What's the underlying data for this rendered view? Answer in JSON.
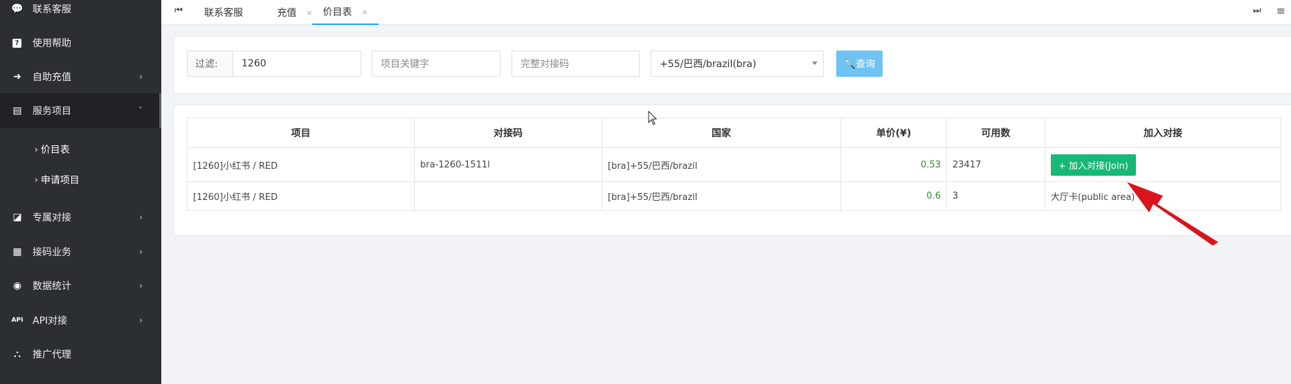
{
  "sidebar": {
    "items": [
      {
        "icon": "chat-icon",
        "glyph": "💬",
        "label": "联系客服",
        "arrow": ""
      },
      {
        "icon": "help-icon",
        "glyph": "?",
        "label": "使用帮助",
        "arrow": ""
      },
      {
        "icon": "recharge-icon",
        "glyph": "➜",
        "label": "自助充值",
        "arrow": "›"
      },
      {
        "icon": "service-icon",
        "glyph": "▤",
        "label": "服务项目",
        "arrow": "ˇ"
      },
      {
        "icon": "exclusive-icon",
        "glyph": "◪",
        "label": "专属对接",
        "arrow": "›"
      },
      {
        "icon": "sms-icon",
        "glyph": "▦",
        "label": "接码业务",
        "arrow": "›"
      },
      {
        "icon": "stats-icon",
        "glyph": "◉",
        "label": "数据统计",
        "arrow": "›"
      },
      {
        "icon": "api-icon",
        "glyph": "API",
        "label": "API对接",
        "arrow": "›"
      },
      {
        "icon": "promote-icon",
        "glyph": "⛬",
        "label": "推广代理",
        "arrow": ""
      }
    ],
    "sub_items": [
      {
        "label": "价目表"
      },
      {
        "label": "申请项目"
      }
    ]
  },
  "tabs": {
    "first_glyph": "⏮",
    "last_glyph": "⏭",
    "menu_glyph": "≡",
    "items": [
      {
        "label": "联系客服",
        "close": ""
      },
      {
        "label": "充值",
        "close": "×"
      },
      {
        "label": "价目表",
        "close": "×"
      }
    ]
  },
  "filter": {
    "label": "过滤:",
    "value": "1260",
    "keyword_placeholder": "项目关键字",
    "code_placeholder": "完整对接码",
    "country_selected": "+55/巴西/brazil(bra)",
    "query_label": "🔍查询"
  },
  "table": {
    "headers": [
      "项目",
      "对接码",
      "国家",
      "单价(¥)",
      "可用数",
      "加入对接"
    ],
    "rows": [
      {
        "project": "[1260]小红书 / RED",
        "code": "bra-1260-1511l",
        "country": "[bra]+55/巴西/brazil",
        "price": "0.53",
        "available": "23417",
        "action": "+ 加入对接(Join)"
      },
      {
        "project": "[1260]小红书 / RED",
        "code": "",
        "country": "[bra]+55/巴西/brazil",
        "price": "0.6",
        "available": "3",
        "action": "大厅卡(public area)"
      }
    ]
  },
  "colors": {
    "sidebar_bg": "#2b2e33",
    "accent": "#1e9fff",
    "query_button": "#6ec3f5",
    "join_button": "#16b777",
    "price_text": "#2a8a2a",
    "annotation_arrow": "#d9141b"
  }
}
